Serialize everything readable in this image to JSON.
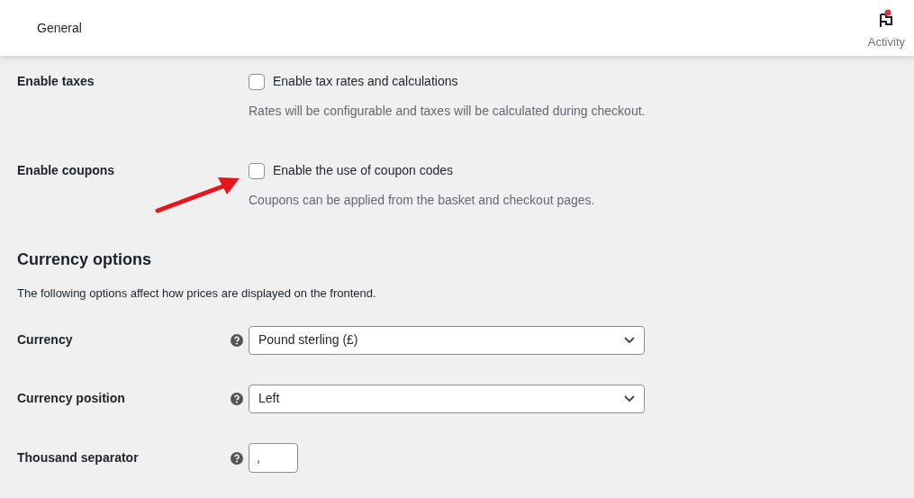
{
  "header": {
    "title": "General",
    "activity": {
      "label": "Activity",
      "unread": true
    }
  },
  "checkbox_settings": [
    {
      "label": "Enable taxes",
      "option": "Enable tax rates and calculations",
      "checked": false,
      "description": "Rates will be configurable and taxes will be calculated during checkout."
    },
    {
      "label": "Enable coupons",
      "option": "Enable the use of coupon codes",
      "checked": false,
      "description": "Coupons can be applied from the basket and checkout pages."
    }
  ],
  "section": {
    "title": "Currency options",
    "description": "The following options affect how prices are displayed on the frontend."
  },
  "fields": [
    {
      "label": "Currency",
      "kind": "select",
      "value": "Pound sterling (£)"
    },
    {
      "label": "Currency position",
      "kind": "select",
      "value": "Left"
    },
    {
      "label": "Thousand separator",
      "kind": "text",
      "value": ","
    }
  ]
}
